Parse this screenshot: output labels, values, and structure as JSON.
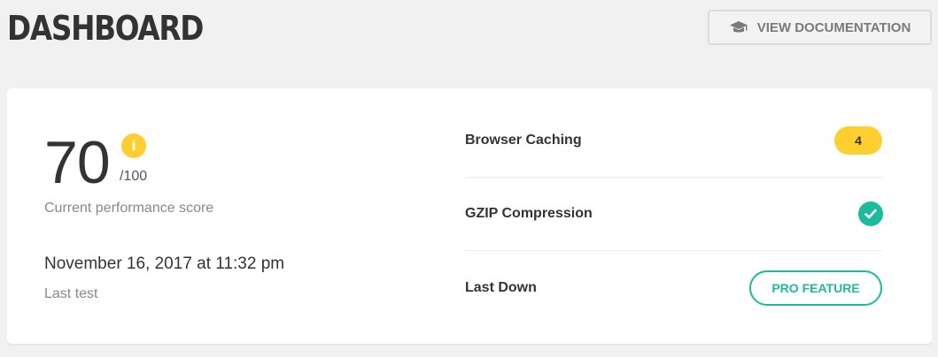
{
  "header": {
    "title": "DASHBOARD",
    "doc_button_label": "VIEW DOCUMENTATION",
    "doc_button_icon": "graduation-cap-icon"
  },
  "summary": {
    "score": "70",
    "score_max": "/100",
    "score_label": "Current performance score",
    "info_icon_glyph": "i",
    "test_date": "November 16, 2017 at 11:32 pm",
    "test_label": "Last test"
  },
  "checks": [
    {
      "label": "Browser Caching",
      "badge": "4"
    },
    {
      "label": "GZIP Compression",
      "icon": "check-circle-icon"
    },
    {
      "label": "Last Down",
      "action_label": "PRO FEATURE"
    }
  ],
  "colors": {
    "accent_green": "#1abc9c",
    "warning_yellow": "#fecf2f",
    "background": "#f1f1f1",
    "card": "#ffffff"
  }
}
